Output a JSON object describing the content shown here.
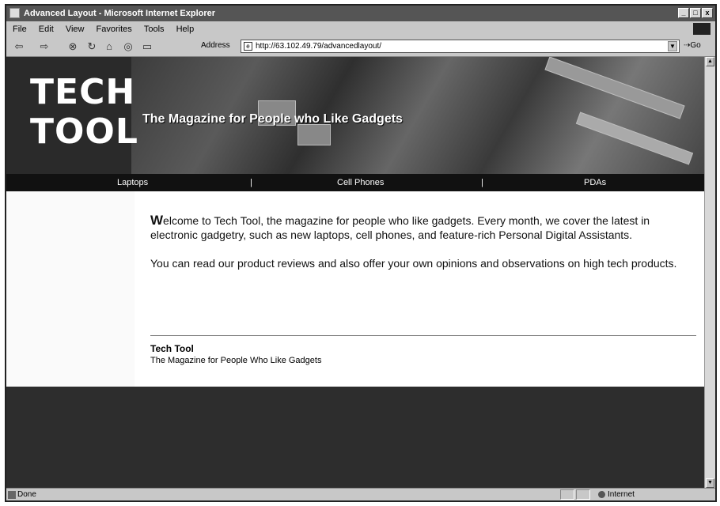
{
  "window": {
    "title": "Advanced Layout - Microsoft Internet Explorer",
    "controls": {
      "minimize": "_",
      "maximize": "□",
      "close": "x"
    }
  },
  "menu": {
    "file": "File",
    "edit": "Edit",
    "view": "View",
    "favorites": "Favorites",
    "tools": "Tools",
    "help": "Help"
  },
  "toolbar": {
    "back_icon": "back-arrow-icon",
    "forward_icon": "forward-arrow-icon",
    "stop_icon": "stop-icon",
    "refresh_icon": "refresh-icon",
    "home_icon": "home-icon",
    "search_icon": "search-icon",
    "print_icon": "print-icon",
    "address_label": "Address",
    "url": "http://63.102.49.79/advancedlayout/",
    "go_label": "Go"
  },
  "page": {
    "logo_line1": "TECH",
    "logo_line2": "TOOL",
    "tagline": "The Magazine for People who Like Gadgets",
    "nav": [
      {
        "label": "Laptops"
      },
      {
        "label": "Cell Phones"
      },
      {
        "label": "PDAs"
      }
    ],
    "nav_separator": "|",
    "intro_dropcap": "W",
    "intro_rest": "elcome to Tech Tool, the magazine for people who like gadgets. Every month, we cover the latest in electronic gadgetry, such as new laptops, cell phones, and feature-rich Personal Digital Assistants.",
    "paragraph2": "You can read our product reviews and also offer your own opinions and observations on high tech products.",
    "footer_title": "Tech Tool",
    "footer_subtitle": "The Magazine for People Who Like Gadgets"
  },
  "status": {
    "text": "Done",
    "zone": "Internet"
  },
  "colors": {
    "header_bg": "#2a2a2a",
    "nav_bg": "#111111",
    "footer_bg": "#2d2d2d"
  }
}
